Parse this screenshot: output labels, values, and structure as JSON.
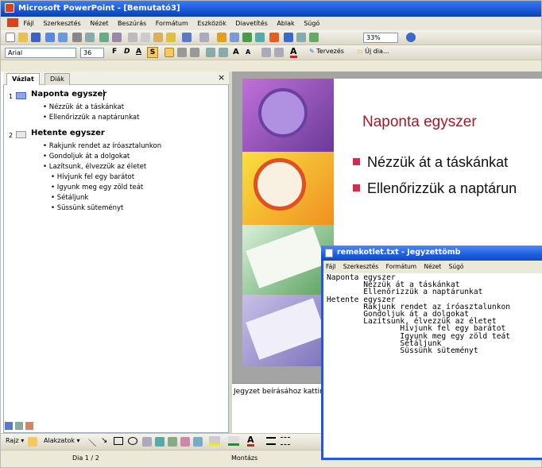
{
  "app": {
    "title": "Microsoft PowerPoint - [Bemutató3]"
  },
  "menu": [
    "Fájl",
    "Szerkesztés",
    "Nézet",
    "Beszúrás",
    "Formátum",
    "Eszközök",
    "Diavetítés",
    "Ablak",
    "Súgó"
  ],
  "toolbar": {
    "zoom": "33%",
    "font": "Arial",
    "size": "36",
    "bold": "F",
    "italic": "D",
    "underline": "A",
    "shadow": "S",
    "design": "Tervezés",
    "new_slide": "Új dia..."
  },
  "pane": {
    "tab_outline": "Vázlat",
    "tab_slides": "Diák",
    "close": "×"
  },
  "outline": {
    "slides": [
      {
        "num": "1",
        "title": "Naponta egyszer",
        "items": [
          "Nézzük át a táskánkat",
          "Ellenőrizzük a naptárunkat"
        ]
      },
      {
        "num": "2",
        "title": "Hetente egyszer",
        "items": [
          "Rakjunk rendet az íróasztalunkon",
          "Gondoljuk át a dolgokat",
          "Lazítsunk, élvezzük az életet"
        ],
        "subitems": [
          "Hívjunk fel egy barátot",
          "Igyunk meg egy zöld teát",
          "Sétáljunk",
          "Süssünk süteményt"
        ]
      }
    ]
  },
  "slide": {
    "title": "Naponta egyszer",
    "bullets": [
      "Nézzük át a táskánkat",
      "Ellenőrizzük a naptárun"
    ]
  },
  "notes": {
    "placeholder": "Jegyzet beírásához kattin"
  },
  "drawing": {
    "draw": "Rajz",
    "autoshapes": "Alakzatok"
  },
  "status": {
    "slide": "Dia 1 / 2",
    "design": "Montázs"
  },
  "notepad": {
    "title": "remekotlet.txt - Jegyzettömb",
    "menu": [
      "Fájl",
      "Szerkesztés",
      "Formátum",
      "Nézet",
      "Súgó"
    ],
    "content": "Naponta egyszer\n        Nézzük át a táskánkat\n        Ellenőrizzük a naptárunkat\nHetente egyszer\n        Rakjunk rendet az íróasztalunkon\n        Gondoljuk át a dolgokat\n        Lazítsunk, élvezzük az életet\n                Hívjunk fel egy barátot\n                Igyunk meg egy zöld teát\n                Sétáljunk\n                Süssünk süteményt"
  },
  "colors": {
    "title_bar": "#1b55d6",
    "slide_title": "#a01a2a",
    "bullet": "#d42a56"
  }
}
